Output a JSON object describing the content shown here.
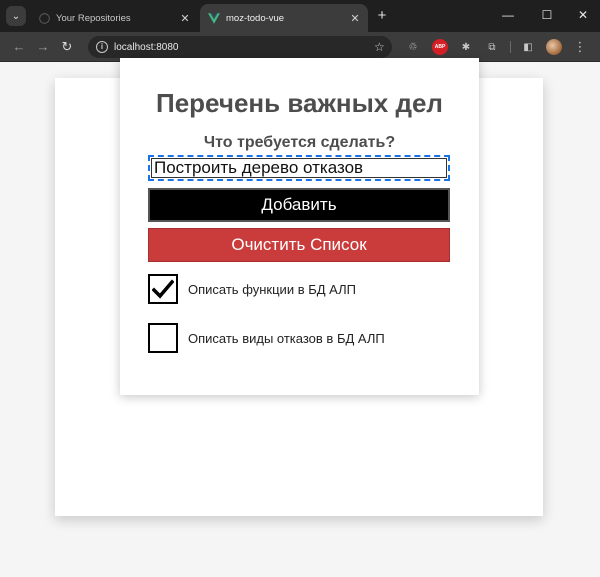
{
  "browser": {
    "tabs": [
      {
        "title": "Your Repositories",
        "icon": "github-icon",
        "active": false
      },
      {
        "title": "moz-todo-vue",
        "icon": "vue-logo-icon",
        "active": true
      }
    ],
    "url": "localhost:8080"
  },
  "app": {
    "heading": "Перечень важных дел",
    "label": "Что требуется сделать?",
    "input_value": "Построить дерево отказов",
    "add_button": "Добавить",
    "clear_button": "Очистить Список",
    "todos": [
      {
        "label": "Описать функции в БД АЛП",
        "done": true
      },
      {
        "label": "Описать виды отказов в БД АЛП",
        "done": false
      }
    ]
  },
  "colors": {
    "add_button_bg": "#000000",
    "clear_button_bg": "#ca3c3c",
    "text": "#4d4d4d",
    "input_focus": "#1a73e8"
  }
}
